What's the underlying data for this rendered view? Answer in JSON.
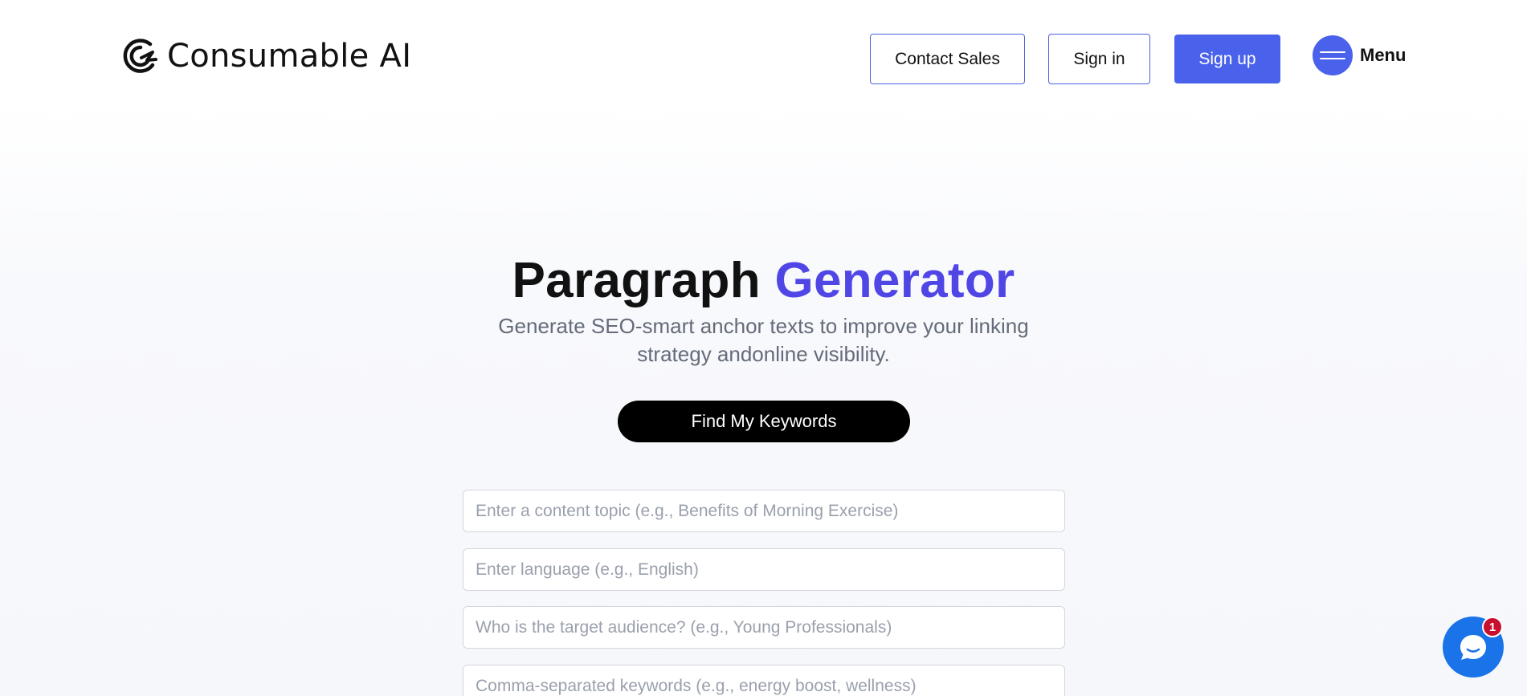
{
  "brand": {
    "name": "Consumable AI",
    "accent_color": "#4a62eb",
    "title_accent_color": "#4f46e5"
  },
  "header": {
    "contact_sales_label": "Contact Sales",
    "sign_in_label": "Sign in",
    "sign_up_label": "Sign up",
    "menu_label": "Menu",
    "menu_icon": "hamburger-icon"
  },
  "hero": {
    "title_main": "Paragraph",
    "title_accent": "Generator",
    "subtitle": "Generate SEO-smart anchor texts to improve your linking strategy andonline visibility.",
    "cta_label": "Find My Keywords"
  },
  "form": {
    "topic": {
      "value": "",
      "placeholder": "Enter a content topic (e.g., Benefits of Morning Exercise)"
    },
    "language": {
      "value": "",
      "placeholder": "Enter language (e.g., English)"
    },
    "audience": {
      "value": "",
      "placeholder": "Who is the target audience? (e.g., Young Professionals)"
    },
    "keywords": {
      "value": "",
      "placeholder": "Comma-separated keywords (e.g., energy boost, wellness)"
    }
  },
  "chat_widget": {
    "icon": "chat-bubble-icon",
    "badge_count": "1",
    "color": "#1a73e8",
    "badge_color": "#c8102e"
  }
}
